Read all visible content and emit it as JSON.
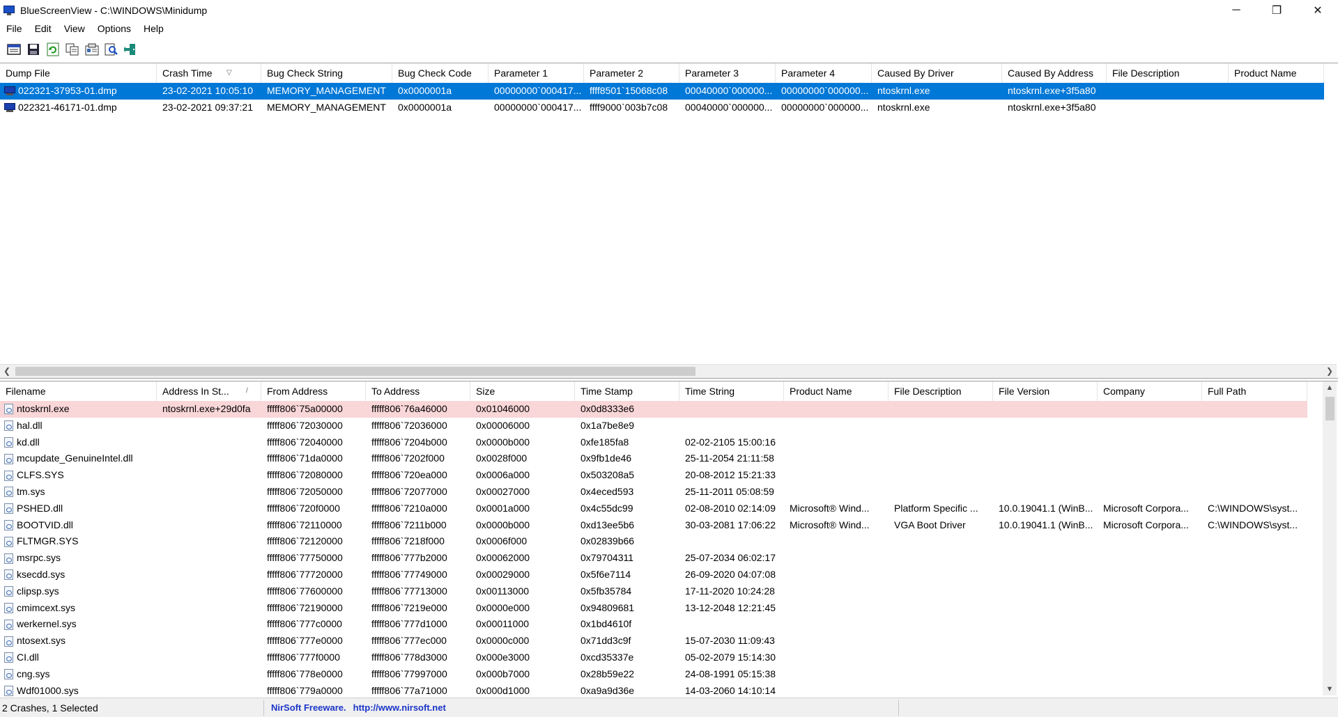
{
  "window": {
    "title": "BlueScreenView  -  C:\\WINDOWS\\Minidump",
    "minimize": "─",
    "maximize": "❐",
    "close": "✕"
  },
  "menu": [
    "File",
    "Edit",
    "View",
    "Options",
    "Help"
  ],
  "toolbar": [
    "properties-icon",
    "save-icon",
    "refresh-icon",
    "copy-icon",
    "html-report-icon",
    "find-icon",
    "exit-icon"
  ],
  "crashes": {
    "columns": [
      "Dump File",
      "Crash Time",
      "Bug Check String",
      "Bug Check Code",
      "Parameter 1",
      "Parameter 2",
      "Parameter 3",
      "Parameter 4",
      "Caused By Driver",
      "Caused By Address",
      "File Description",
      "Product Name"
    ],
    "rows": [
      [
        "022321-37953-01.dmp",
        "23-02-2021 10:05:10",
        "MEMORY_MANAGEMENT",
        "0x0000001a",
        "00000000`000417...",
        "ffff8501`15068c08",
        "00040000`000000...",
        "00000000`000000...",
        "ntoskrnl.exe",
        "ntoskrnl.exe+3f5a80",
        "",
        ""
      ],
      [
        "022321-46171-01.dmp",
        "23-02-2021 09:37:21",
        "MEMORY_MANAGEMENT",
        "0x0000001a",
        "00000000`000417...",
        "ffff9000`003b7c08",
        "00040000`000000...",
        "00000000`000000...",
        "ntoskrnl.exe",
        "ntoskrnl.exe+3f5a80",
        "",
        ""
      ]
    ],
    "selected_row": 0,
    "sort_column": "Crash Time",
    "sort_indicator": "▽"
  },
  "modules": {
    "columns": [
      "Filename",
      "Address In St...",
      "From Address",
      "To Address",
      "Size",
      "Time Stamp",
      "Time String",
      "Product Name",
      "File Description",
      "File Version",
      "Company",
      "Full Path"
    ],
    "sort_indicator": "/",
    "highlighted_row": 0,
    "rows": [
      [
        "ntoskrnl.exe",
        "ntoskrnl.exe+29d0fa",
        "fffff806`75a00000",
        "fffff806`76a46000",
        "0x01046000",
        "0x0d8333e6",
        "",
        "",
        "",
        "",
        "",
        ""
      ],
      [
        "hal.dll",
        "",
        "fffff806`72030000",
        "fffff806`72036000",
        "0x00006000",
        "0x1a7be8e9",
        "",
        "",
        "",
        "",
        "",
        ""
      ],
      [
        "kd.dll",
        "",
        "fffff806`72040000",
        "fffff806`7204b000",
        "0x0000b000",
        "0xfe185fa8",
        "02-02-2105 15:00:16",
        "",
        "",
        "",
        "",
        ""
      ],
      [
        "mcupdate_GenuineIntel.dll",
        "",
        "fffff806`71da0000",
        "fffff806`7202f000",
        "0x0028f000",
        "0x9fb1de46",
        "25-11-2054 21:11:58",
        "",
        "",
        "",
        "",
        ""
      ],
      [
        "CLFS.SYS",
        "",
        "fffff806`72080000",
        "fffff806`720ea000",
        "0x0006a000",
        "0x503208a5",
        "20-08-2012 15:21:33",
        "",
        "",
        "",
        "",
        ""
      ],
      [
        "tm.sys",
        "",
        "fffff806`72050000",
        "fffff806`72077000",
        "0x00027000",
        "0x4eced593",
        "25-11-2011 05:08:59",
        "",
        "",
        "",
        "",
        ""
      ],
      [
        "PSHED.dll",
        "",
        "fffff806`720f0000",
        "fffff806`7210a000",
        "0x0001a000",
        "0x4c55dc99",
        "02-08-2010 02:14:09",
        "Microsoft® Wind...",
        "Platform Specific ...",
        "10.0.19041.1 (WinB...",
        "Microsoft Corpora...",
        "C:\\WINDOWS\\syst..."
      ],
      [
        "BOOTVID.dll",
        "",
        "fffff806`72110000",
        "fffff806`7211b000",
        "0x0000b000",
        "0xd13ee5b6",
        "30-03-2081 17:06:22",
        "Microsoft® Wind...",
        "VGA Boot Driver",
        "10.0.19041.1 (WinB...",
        "Microsoft Corpora...",
        "C:\\WINDOWS\\syst..."
      ],
      [
        "FLTMGR.SYS",
        "",
        "fffff806`72120000",
        "fffff806`7218f000",
        "0x0006f000",
        "0x02839b66",
        "",
        "",
        "",
        "",
        "",
        ""
      ],
      [
        "msrpc.sys",
        "",
        "fffff806`77750000",
        "fffff806`777b2000",
        "0x00062000",
        "0x79704311",
        "25-07-2034 06:02:17",
        "",
        "",
        "",
        "",
        ""
      ],
      [
        "ksecdd.sys",
        "",
        "fffff806`77720000",
        "fffff806`77749000",
        "0x00029000",
        "0x5f6e7114",
        "26-09-2020 04:07:08",
        "",
        "",
        "",
        "",
        ""
      ],
      [
        "clipsp.sys",
        "",
        "fffff806`77600000",
        "fffff806`77713000",
        "0x00113000",
        "0x5fb35784",
        "17-11-2020 10:24:28",
        "",
        "",
        "",
        "",
        ""
      ],
      [
        "cmimcext.sys",
        "",
        "fffff806`72190000",
        "fffff806`7219e000",
        "0x0000e000",
        "0x94809681",
        "13-12-2048 12:21:45",
        "",
        "",
        "",
        "",
        ""
      ],
      [
        "werkernel.sys",
        "",
        "fffff806`777c0000",
        "fffff806`777d1000",
        "0x00011000",
        "0x1bd4610f",
        "",
        "",
        "",
        "",
        "",
        ""
      ],
      [
        "ntosext.sys",
        "",
        "fffff806`777e0000",
        "fffff806`777ec000",
        "0x0000c000",
        "0x71dd3c9f",
        "15-07-2030 11:09:43",
        "",
        "",
        "",
        "",
        ""
      ],
      [
        "CI.dll",
        "",
        "fffff806`777f0000",
        "fffff806`778d3000",
        "0x000e3000",
        "0xcd35337e",
        "05-02-2079 15:14:30",
        "",
        "",
        "",
        "",
        ""
      ],
      [
        "cng.sys",
        "",
        "fffff806`778e0000",
        "fffff806`77997000",
        "0x000b7000",
        "0x28b59e22",
        "24-08-1991 05:15:38",
        "",
        "",
        "",
        "",
        ""
      ],
      [
        "Wdf01000.sys",
        "",
        "fffff806`779a0000",
        "fffff806`77a71000",
        "0x000d1000",
        "0xa9a9d36e",
        "14-03-2060 14:10:14",
        "",
        "",
        "",
        "",
        ""
      ]
    ]
  },
  "status": {
    "crashes": "2 Crashes, 1 Selected",
    "freeware": "NirSoft Freeware.",
    "url": "http://www.nirsoft.net"
  },
  "colors": {
    "selection": "#0078d7",
    "highlight": "#f9d6d8",
    "link": "#1a35c8"
  }
}
